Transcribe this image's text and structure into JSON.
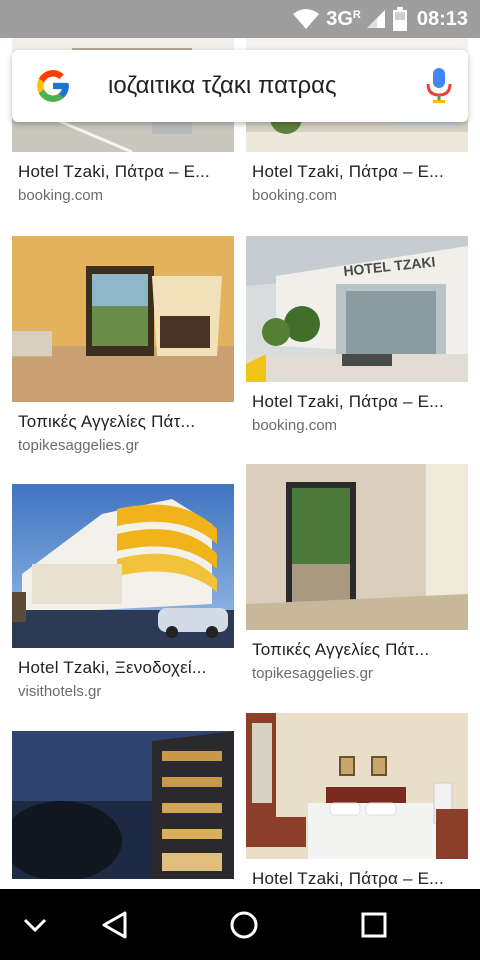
{
  "status_bar": {
    "network": "3G",
    "network_sup": "R",
    "time": "08:13"
  },
  "search": {
    "query": "ιοζαιτικα τζακι πατρας"
  },
  "results": [
    {
      "title": "Hotel Tzaki, Πάτρα – Ε...",
      "source": "booking.com"
    },
    {
      "title": "Hotel Tzaki, Πάτρα – Ε...",
      "source": "booking.com"
    },
    {
      "title": "Τοπικές Αγγελίες Πάτ...",
      "source": "topikesaggelies.gr"
    },
    {
      "title": "Hotel Tzaki, Πάτρα – Ε...",
      "source": "booking.com"
    },
    {
      "title": "Hotel Tzaki, Ξενοδοχεί...",
      "source": "visithotels.gr"
    },
    {
      "title": "Τοπικές Αγγελίες Πάτ...",
      "source": "topikesaggelies.gr"
    },
    {
      "title": "",
      "source": ""
    },
    {
      "title": "Hotel Tzaki, Πάτρα – Ε...",
      "source": ""
    }
  ],
  "thumbnails": {
    "hotel_facade_sign": "HOTEL TZAKI"
  },
  "icons": {
    "wifi": "wifi-icon",
    "signal": "signal-icon",
    "battery": "battery-icon",
    "google": "google-logo-icon",
    "mic": "microphone-icon",
    "nav_down": "chevron-down-icon",
    "nav_back": "back-triangle-icon",
    "nav_home": "home-circle-icon",
    "nav_recents": "recents-square-icon"
  },
  "colors": {
    "status_bar": "#9e9e9e",
    "nav_bar": "#000000",
    "title_text": "#222222",
    "source_text": "#6b6b6b"
  }
}
